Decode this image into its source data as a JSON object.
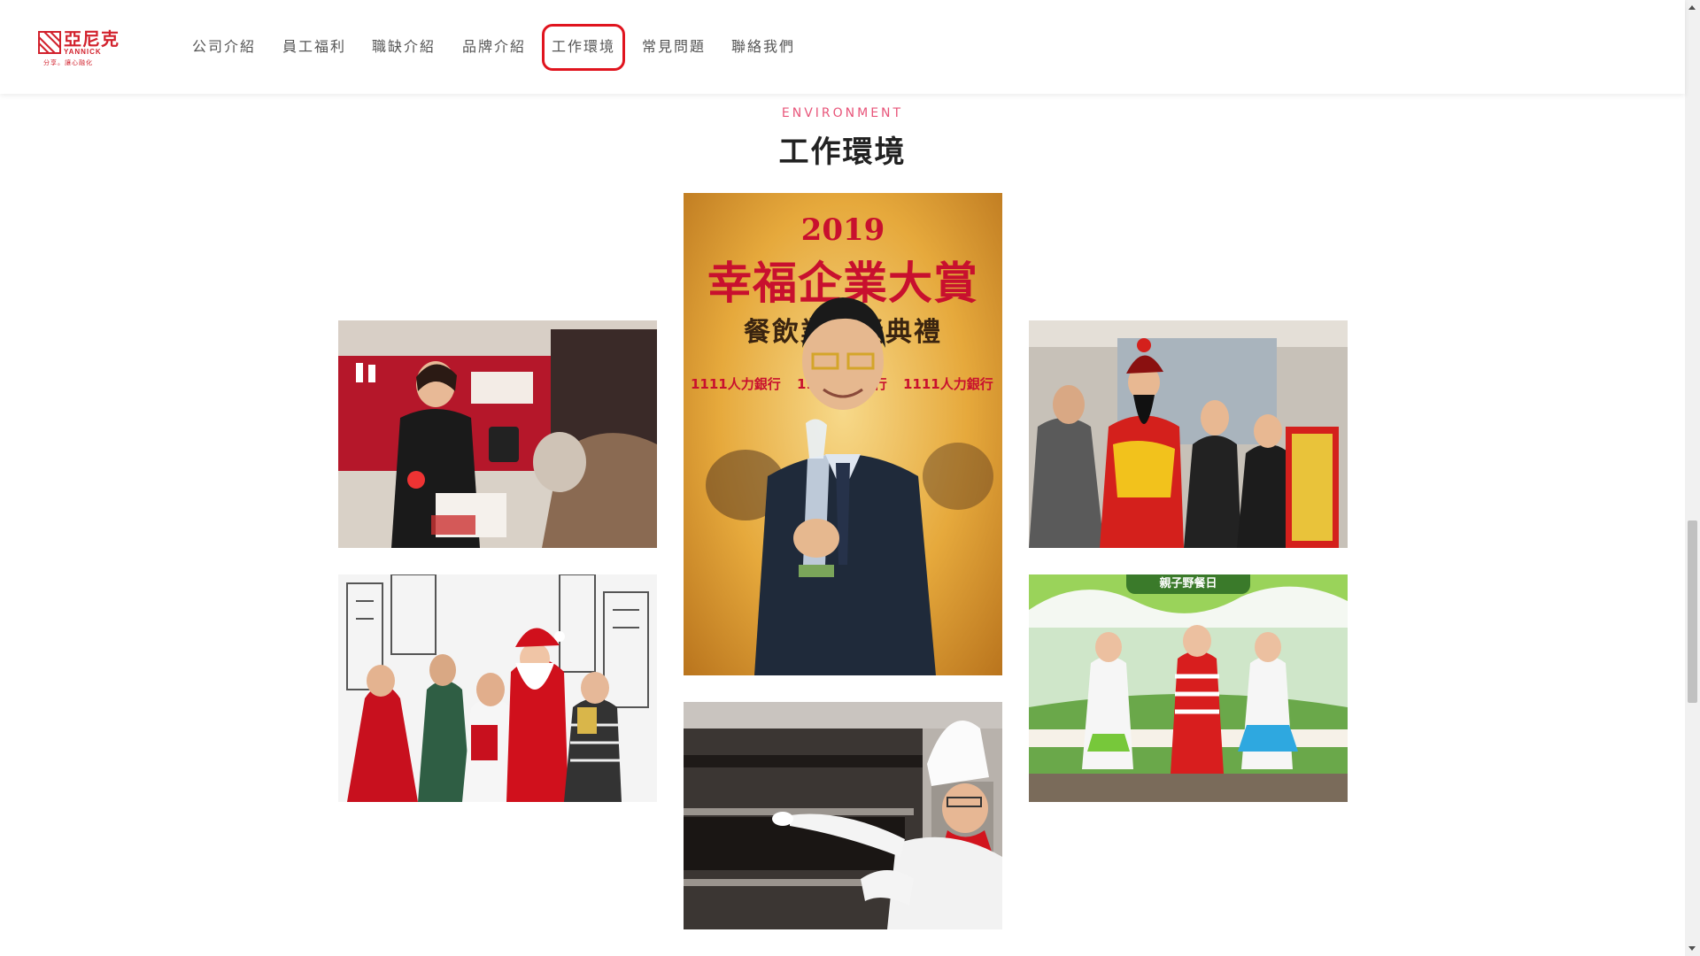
{
  "logo": {
    "title": "亞尼克",
    "english": "YANNICK",
    "slogan": "分享。讓心融化"
  },
  "nav": {
    "items": [
      {
        "label": "公司介紹"
      },
      {
        "label": "員工福利"
      },
      {
        "label": "職缺介紹"
      },
      {
        "label": "品牌介紹"
      },
      {
        "label": "工作環境",
        "active": true
      },
      {
        "label": "常見問題"
      },
      {
        "label": "聯絡我們"
      }
    ]
  },
  "section": {
    "subtitle": "ENVIRONMENT",
    "title": "工作環境"
  },
  "poster": {
    "year": "2019",
    "title": "幸福企業大賞",
    "subtitle": "餐飲業頒獎典禮",
    "brand": "1111人力銀行"
  },
  "photo_banner": {
    "festival_sign": "親子野餐日"
  },
  "colors": {
    "brand_red": "#d2222d",
    "accent_pink": "#e8557a",
    "highlight_ring": "#e0141e",
    "nav_text": "#555555"
  }
}
